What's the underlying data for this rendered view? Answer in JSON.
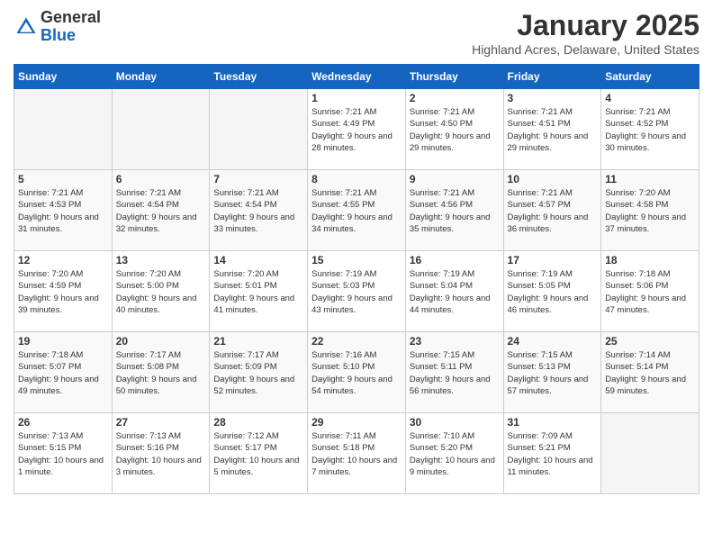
{
  "header": {
    "logo_general": "General",
    "logo_blue": "Blue",
    "month_title": "January 2025",
    "location": "Highland Acres, Delaware, United States"
  },
  "weekdays": [
    "Sunday",
    "Monday",
    "Tuesday",
    "Wednesday",
    "Thursday",
    "Friday",
    "Saturday"
  ],
  "weeks": [
    [
      {
        "day": "",
        "empty": true
      },
      {
        "day": "",
        "empty": true
      },
      {
        "day": "",
        "empty": true
      },
      {
        "day": "1",
        "sunrise": "Sunrise: 7:21 AM",
        "sunset": "Sunset: 4:49 PM",
        "daylight": "Daylight: 9 hours and 28 minutes."
      },
      {
        "day": "2",
        "sunrise": "Sunrise: 7:21 AM",
        "sunset": "Sunset: 4:50 PM",
        "daylight": "Daylight: 9 hours and 29 minutes."
      },
      {
        "day": "3",
        "sunrise": "Sunrise: 7:21 AM",
        "sunset": "Sunset: 4:51 PM",
        "daylight": "Daylight: 9 hours and 29 minutes."
      },
      {
        "day": "4",
        "sunrise": "Sunrise: 7:21 AM",
        "sunset": "Sunset: 4:52 PM",
        "daylight": "Daylight: 9 hours and 30 minutes."
      }
    ],
    [
      {
        "day": "5",
        "sunrise": "Sunrise: 7:21 AM",
        "sunset": "Sunset: 4:53 PM",
        "daylight": "Daylight: 9 hours and 31 minutes."
      },
      {
        "day": "6",
        "sunrise": "Sunrise: 7:21 AM",
        "sunset": "Sunset: 4:54 PM",
        "daylight": "Daylight: 9 hours and 32 minutes."
      },
      {
        "day": "7",
        "sunrise": "Sunrise: 7:21 AM",
        "sunset": "Sunset: 4:54 PM",
        "daylight": "Daylight: 9 hours and 33 minutes."
      },
      {
        "day": "8",
        "sunrise": "Sunrise: 7:21 AM",
        "sunset": "Sunset: 4:55 PM",
        "daylight": "Daylight: 9 hours and 34 minutes."
      },
      {
        "day": "9",
        "sunrise": "Sunrise: 7:21 AM",
        "sunset": "Sunset: 4:56 PM",
        "daylight": "Daylight: 9 hours and 35 minutes."
      },
      {
        "day": "10",
        "sunrise": "Sunrise: 7:21 AM",
        "sunset": "Sunset: 4:57 PM",
        "daylight": "Daylight: 9 hours and 36 minutes."
      },
      {
        "day": "11",
        "sunrise": "Sunrise: 7:20 AM",
        "sunset": "Sunset: 4:58 PM",
        "daylight": "Daylight: 9 hours and 37 minutes."
      }
    ],
    [
      {
        "day": "12",
        "sunrise": "Sunrise: 7:20 AM",
        "sunset": "Sunset: 4:59 PM",
        "daylight": "Daylight: 9 hours and 39 minutes."
      },
      {
        "day": "13",
        "sunrise": "Sunrise: 7:20 AM",
        "sunset": "Sunset: 5:00 PM",
        "daylight": "Daylight: 9 hours and 40 minutes."
      },
      {
        "day": "14",
        "sunrise": "Sunrise: 7:20 AM",
        "sunset": "Sunset: 5:01 PM",
        "daylight": "Daylight: 9 hours and 41 minutes."
      },
      {
        "day": "15",
        "sunrise": "Sunrise: 7:19 AM",
        "sunset": "Sunset: 5:03 PM",
        "daylight": "Daylight: 9 hours and 43 minutes."
      },
      {
        "day": "16",
        "sunrise": "Sunrise: 7:19 AM",
        "sunset": "Sunset: 5:04 PM",
        "daylight": "Daylight: 9 hours and 44 minutes."
      },
      {
        "day": "17",
        "sunrise": "Sunrise: 7:19 AM",
        "sunset": "Sunset: 5:05 PM",
        "daylight": "Daylight: 9 hours and 46 minutes."
      },
      {
        "day": "18",
        "sunrise": "Sunrise: 7:18 AM",
        "sunset": "Sunset: 5:06 PM",
        "daylight": "Daylight: 9 hours and 47 minutes."
      }
    ],
    [
      {
        "day": "19",
        "sunrise": "Sunrise: 7:18 AM",
        "sunset": "Sunset: 5:07 PM",
        "daylight": "Daylight: 9 hours and 49 minutes."
      },
      {
        "day": "20",
        "sunrise": "Sunrise: 7:17 AM",
        "sunset": "Sunset: 5:08 PM",
        "daylight": "Daylight: 9 hours and 50 minutes."
      },
      {
        "day": "21",
        "sunrise": "Sunrise: 7:17 AM",
        "sunset": "Sunset: 5:09 PM",
        "daylight": "Daylight: 9 hours and 52 minutes."
      },
      {
        "day": "22",
        "sunrise": "Sunrise: 7:16 AM",
        "sunset": "Sunset: 5:10 PM",
        "daylight": "Daylight: 9 hours and 54 minutes."
      },
      {
        "day": "23",
        "sunrise": "Sunrise: 7:15 AM",
        "sunset": "Sunset: 5:11 PM",
        "daylight": "Daylight: 9 hours and 56 minutes."
      },
      {
        "day": "24",
        "sunrise": "Sunrise: 7:15 AM",
        "sunset": "Sunset: 5:13 PM",
        "daylight": "Daylight: 9 hours and 57 minutes."
      },
      {
        "day": "25",
        "sunrise": "Sunrise: 7:14 AM",
        "sunset": "Sunset: 5:14 PM",
        "daylight": "Daylight: 9 hours and 59 minutes."
      }
    ],
    [
      {
        "day": "26",
        "sunrise": "Sunrise: 7:13 AM",
        "sunset": "Sunset: 5:15 PM",
        "daylight": "Daylight: 10 hours and 1 minute."
      },
      {
        "day": "27",
        "sunrise": "Sunrise: 7:13 AM",
        "sunset": "Sunset: 5:16 PM",
        "daylight": "Daylight: 10 hours and 3 minutes."
      },
      {
        "day": "28",
        "sunrise": "Sunrise: 7:12 AM",
        "sunset": "Sunset: 5:17 PM",
        "daylight": "Daylight: 10 hours and 5 minutes."
      },
      {
        "day": "29",
        "sunrise": "Sunrise: 7:11 AM",
        "sunset": "Sunset: 5:18 PM",
        "daylight": "Daylight: 10 hours and 7 minutes."
      },
      {
        "day": "30",
        "sunrise": "Sunrise: 7:10 AM",
        "sunset": "Sunset: 5:20 PM",
        "daylight": "Daylight: 10 hours and 9 minutes."
      },
      {
        "day": "31",
        "sunrise": "Sunrise: 7:09 AM",
        "sunset": "Sunset: 5:21 PM",
        "daylight": "Daylight: 10 hours and 11 minutes."
      },
      {
        "day": "",
        "empty": true
      }
    ]
  ]
}
